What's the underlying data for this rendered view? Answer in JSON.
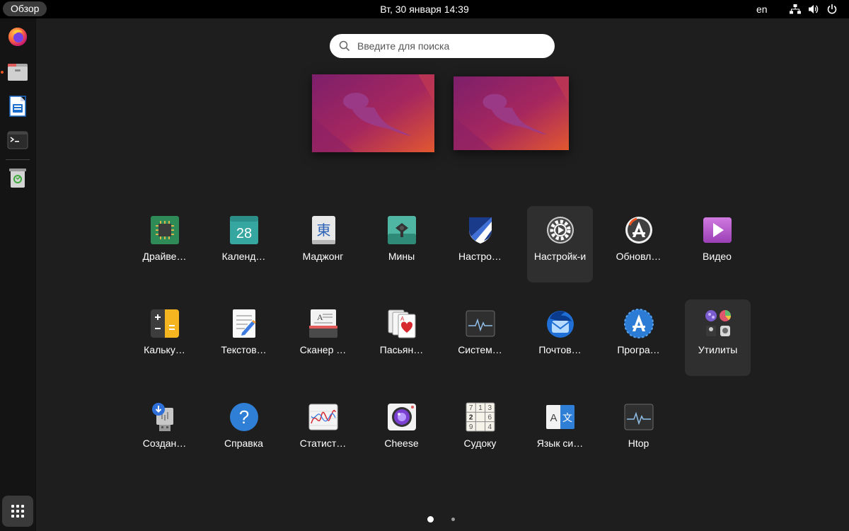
{
  "topbar": {
    "activities_label": "Обзор",
    "clock": "Вт, 30 января  14:39",
    "language": "en",
    "tray_icons": [
      "network-icon",
      "volume-icon",
      "power-icon"
    ]
  },
  "search": {
    "placeholder": "Введите для поиска"
  },
  "dock": {
    "items": [
      "firefox-icon",
      "files-icon",
      "writer-icon",
      "terminal-icon",
      "trash-icon",
      "app-grid-icon"
    ],
    "running_indicator_color": "#e95420"
  },
  "apps": [
    {
      "label": "Драйве…",
      "icon": "chip-icon"
    },
    {
      "label": "Календ…",
      "icon": "calendar-icon",
      "icon_text": "28"
    },
    {
      "label": "Маджонг",
      "icon": "mahjong-icon",
      "icon_text": "東"
    },
    {
      "label": "Мины",
      "icon": "mines-icon"
    },
    {
      "label": "Настро…",
      "icon": "shield-icon"
    },
    {
      "label": "Настройк-и",
      "icon": "settings-gear-icon",
      "highlighted": true
    },
    {
      "label": "Обновл…",
      "icon": "updater-icon"
    },
    {
      "label": "Видео",
      "icon": "video-icon"
    },
    {
      "label": "Кальку…",
      "icon": "calculator-icon"
    },
    {
      "label": "Текстов…",
      "icon": "text-editor-icon"
    },
    {
      "label": "Сканер …",
      "icon": "scanner-icon"
    },
    {
      "label": "Пасьян…",
      "icon": "cards-icon"
    },
    {
      "label": "Систем…",
      "icon": "system-monitor-icon"
    },
    {
      "label": "Почтов…",
      "icon": "thunderbird-icon"
    },
    {
      "label": "Програ…",
      "icon": "software-icon"
    },
    {
      "label": "Утилиты",
      "icon": "folder-utilities-icon",
      "highlighted": true
    },
    {
      "label": "Создан…",
      "icon": "usb-creator-icon"
    },
    {
      "label": "Справка",
      "icon": "help-icon"
    },
    {
      "label": "Статист…",
      "icon": "statistics-icon"
    },
    {
      "label": "Cheese",
      "icon": "camera-icon"
    },
    {
      "label": "Судоку",
      "icon": "sudoku-icon",
      "icon_text": [
        "7",
        "1",
        "3",
        "2",
        "6",
        "9",
        "4"
      ]
    },
    {
      "label": "Язык си…",
      "icon": "language-icon",
      "icon_text": [
        "A",
        "文"
      ]
    },
    {
      "label": "Htop",
      "icon": "htop-icon"
    }
  ],
  "pagination": {
    "pages": 2,
    "current": 1
  },
  "colors": {
    "accent": "#e95420",
    "overview_bg": "#1e1e1e",
    "panel_bg": "#000000",
    "dock_bg": "#141414"
  }
}
